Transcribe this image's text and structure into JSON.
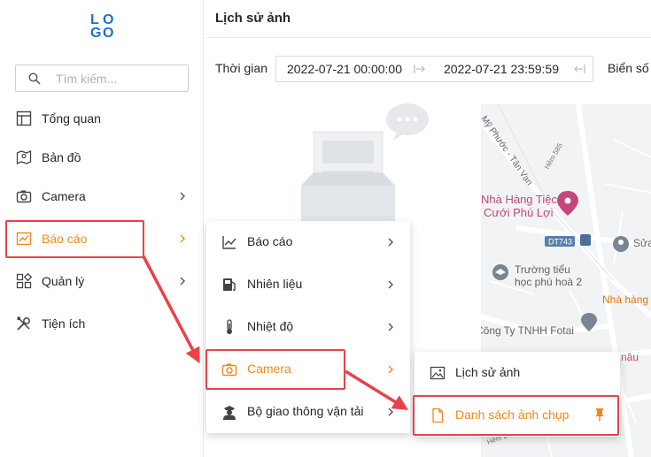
{
  "sidebar": {
    "logo": {
      "line1": [
        "L",
        "O"
      ],
      "line2": [
        "G",
        "O"
      ]
    },
    "search_placeholder": "Tìm kiếm...",
    "items": [
      {
        "label": "Tổng quan",
        "icon": "layout-icon"
      },
      {
        "label": "Bản đồ",
        "icon": "map-icon"
      },
      {
        "label": "Camera",
        "icon": "camera-icon"
      },
      {
        "label": "Báo cáo",
        "icon": "chart-icon",
        "active": true
      },
      {
        "label": "Quản lý",
        "icon": "apps-icon"
      },
      {
        "label": "Tiện ích",
        "icon": "tools-icon"
      }
    ]
  },
  "header": {
    "title": "Lịch sử ảnh",
    "time_label": "Thời gian",
    "date_from": "2022-07-21 00:00:00",
    "date_to": "2022-07-21 23:59:59",
    "plate_label": "Biển số"
  },
  "submenu1": {
    "items": [
      {
        "label": "Báo cáo",
        "icon": "line-chart-icon"
      },
      {
        "label": "Nhiên liệu",
        "icon": "fuel-icon"
      },
      {
        "label": "Nhiệt độ",
        "icon": "thermometer-icon"
      },
      {
        "label": "Camera",
        "icon": "camera-icon",
        "active": true
      },
      {
        "label": "Bộ giao thông vận tải",
        "icon": "officer-icon"
      }
    ]
  },
  "submenu2": {
    "items": [
      {
        "label": "Lịch sử ảnh",
        "icon": "image-icon"
      },
      {
        "label": "Danh sách ảnh chụp",
        "icon": "file-icon",
        "active": true
      }
    ]
  },
  "map": {
    "labels": [
      "Mỹ Phước - Tân Vạn",
      "Hẻm 585",
      "Nhà Hàng Tiệc",
      "Cưới Phú Lợi",
      "DT743",
      "Sửa",
      "Trường tiểu",
      "học phú hoà 2",
      "Nhà hàng",
      "Công Ty TNHH Fotai",
      "nâu",
      "Hẻm 2"
    ]
  },
  "colors": {
    "accent": "#f2891b",
    "highlight": "#e8434a",
    "logo": "#1a73c8"
  }
}
